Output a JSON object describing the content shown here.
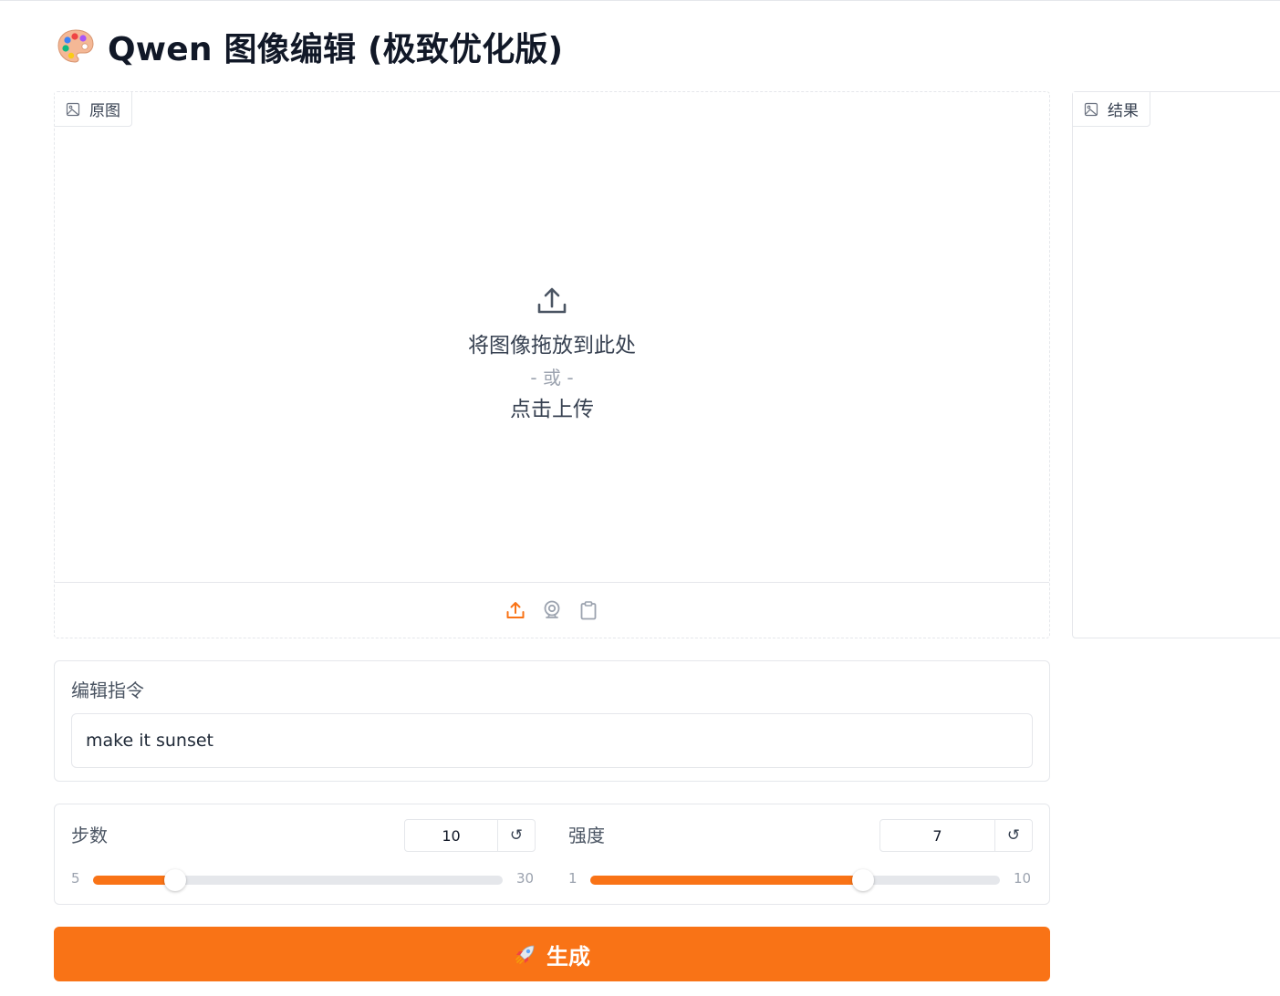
{
  "page": {
    "title": "Qwen 图像编辑 (极致优化版)",
    "title_icon": "palette-icon"
  },
  "input_panel": {
    "label": "原图",
    "drop_text": "将图像拖放到此处",
    "or_text": "- 或 -",
    "click_text": "点击上传",
    "sources": [
      "upload-icon",
      "webcam-icon",
      "clipboard-icon"
    ]
  },
  "output_panel": {
    "label": "结果"
  },
  "instruction": {
    "label": "编辑指令",
    "value": "make it sunset"
  },
  "sliders": {
    "steps": {
      "label": "步数",
      "value": "10",
      "min": "5",
      "max": "30",
      "fraction": 0.2
    },
    "strength": {
      "label": "强度",
      "value": "7",
      "min": "1",
      "max": "10",
      "fraction": 0.6667
    },
    "reset_glyph": "↺"
  },
  "generate": {
    "label": "生成",
    "icon": "rocket-icon"
  },
  "colors": {
    "accent": "#f97316",
    "border": "#e5e7eb"
  }
}
